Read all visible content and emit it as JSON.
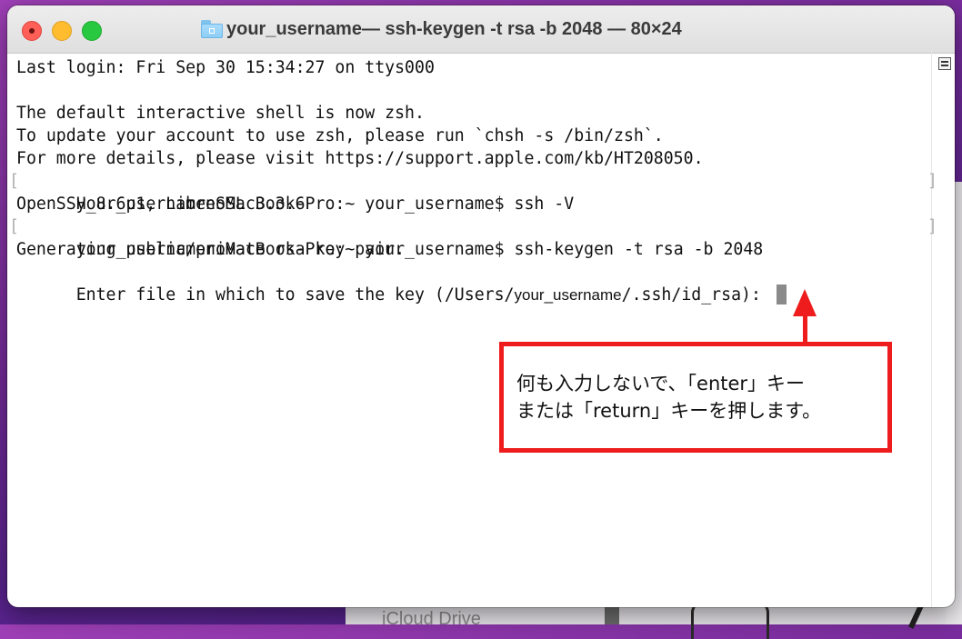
{
  "window": {
    "title_folder": "your_username",
    "title_rest": "— ssh-keygen -t rsa -b 2048 — 80×24"
  },
  "terminal": {
    "lines": [
      "Last login: Fri Sep 30 15:34:27 on ttys000",
      "",
      "The default interactive shell is now zsh.",
      "To update your account to use zsh, please run `chsh -s /bin/zsh`.",
      "For more details, please visit https://support.apple.com/kb/HT208050.",
      "your_usernamenoMacBook-Pro:~ your_username$ ssh -V",
      "OpenSSH_8.6p1, LibreSSL 3.3.6",
      "your_usernamenoMacBook-Pro:~ your_username$ ssh-keygen -t rsa -b 2048",
      "Generating public/private rsa key pair."
    ],
    "prompt_line": {
      "prefix": "Enter file in which to save the key (/Users/",
      "user": "your_username",
      "suffix": "/.ssh/id_rsa): "
    },
    "line_mark_left": "[",
    "line_mark_right": "]"
  },
  "callout": {
    "line1": "何も入力しないで、「enter」キー",
    "line2": "または「return」キーを押します。",
    "color": "#ee1c1c"
  },
  "background": {
    "peek_text": "iCloud Drive"
  }
}
